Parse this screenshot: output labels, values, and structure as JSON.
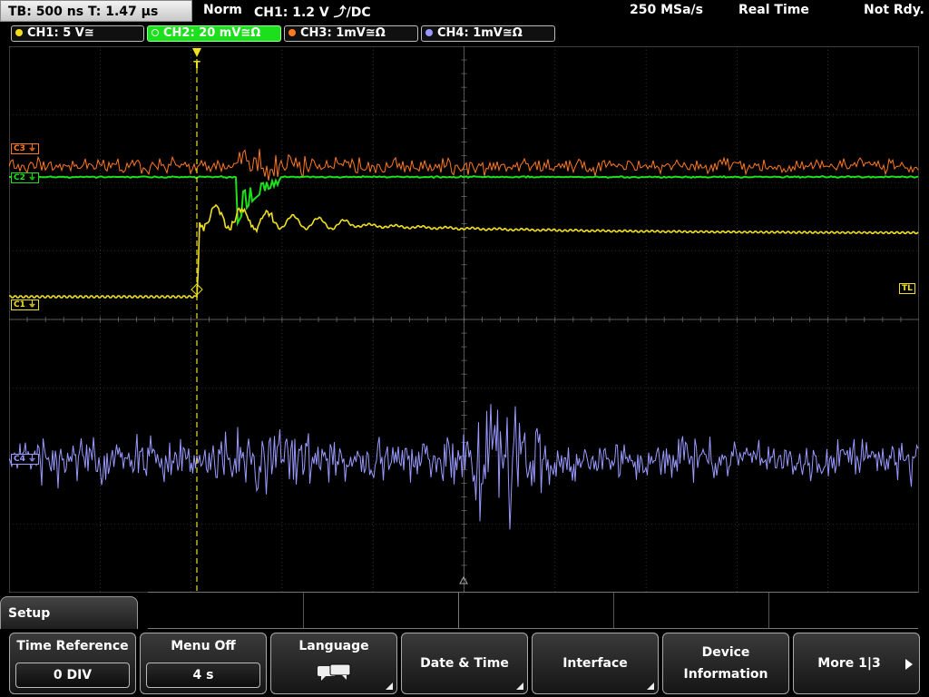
{
  "topbar": {
    "timebase": "TB: 500 ns   T: 1.47 µs",
    "trigger_mode": "Norm",
    "trigger_info": "CH1: 1.2 V ⤴/DC",
    "sample_rate": "250 MSa/s",
    "acq_mode": "Real Time",
    "status": "Not Rdy."
  },
  "channels": [
    {
      "label": "CH1: 5 V≅",
      "color": "#f0e020",
      "active": false
    },
    {
      "label": "CH2: 20 mV≅Ω",
      "color": "#1de01d",
      "active": true
    },
    {
      "label": "CH3: 1mV≅Ω",
      "color": "#ff7a20",
      "active": false
    },
    {
      "label": "CH4: 1mV≅Ω",
      "color": "#9999ff",
      "active": false
    }
  ],
  "markers": {
    "c3": "C3",
    "c2": "C2",
    "c1": "C1",
    "c4": "C4",
    "tl": "TL",
    "trigger": "T"
  },
  "menu": {
    "title": "Setup",
    "keys": {
      "time_reference": {
        "label": "Time Reference",
        "value": "0 DIV"
      },
      "menu_off": {
        "label": "Menu Off",
        "value": "4 s"
      },
      "language": {
        "label": "Language"
      },
      "date_time": {
        "label": "Date & Time"
      },
      "interface": {
        "label": "Interface"
      },
      "device_information": {
        "label": "Device Information"
      },
      "more": {
        "label": "More 1|3"
      }
    }
  },
  "colors": {
    "ch1": "#f0e020",
    "ch2": "#1de01d",
    "ch3": "#ff7a20",
    "ch4": "#9999ff",
    "grid": "#555555"
  }
}
